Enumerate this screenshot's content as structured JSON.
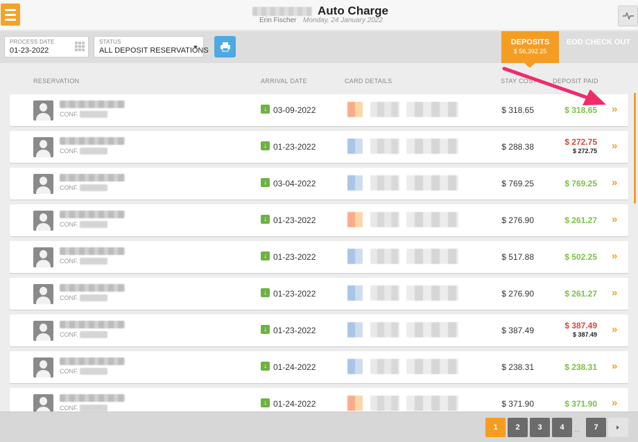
{
  "header": {
    "title": "Auto Charge",
    "user_name": "Erin Fischer",
    "date": "Monday, 24 January 2022"
  },
  "toolbar": {
    "process_date_label": "PROCESS DATE",
    "process_date_value": "01-23-2022",
    "status_label": "STATUS",
    "status_value": "ALL DEPOSIT RESERVATIONS",
    "tabs": {
      "deposits_label": "DEPOSITS",
      "deposits_total": "$ 56,392.25",
      "eod_label": "EOD CHECK OUT"
    }
  },
  "columns": {
    "reservation": "RESERVATION",
    "arrival_date": "ARRIVAL DATE",
    "card_details": "CARD DETAILS",
    "stay_cost": "STAY COST",
    "deposit_paid": "DEPOSIT PAID"
  },
  "rows": [
    {
      "conf_label": "CONF.",
      "arrival": "03-09-2022",
      "card_type": "orange",
      "stay_cost": "$ 318.65",
      "deposit": "$ 318.65",
      "deposit_status": "green",
      "deposit_sub": ""
    },
    {
      "conf_label": "CONF.",
      "arrival": "01-23-2022",
      "card_type": "blue",
      "stay_cost": "$ 288.38",
      "deposit": "$ 272.75",
      "deposit_status": "red",
      "deposit_sub": "$ 272.75"
    },
    {
      "conf_label": "CONF.",
      "arrival": "03-04-2022",
      "card_type": "blue",
      "stay_cost": "$ 769.25",
      "deposit": "$ 769.25",
      "deposit_status": "green",
      "deposit_sub": ""
    },
    {
      "conf_label": "CONF.",
      "arrival": "01-23-2022",
      "card_type": "orange",
      "stay_cost": "$ 276.90",
      "deposit": "$ 261.27",
      "deposit_status": "green",
      "deposit_sub": ""
    },
    {
      "conf_label": "CONF.",
      "arrival": "01-23-2022",
      "card_type": "blue",
      "stay_cost": "$ 517.88",
      "deposit": "$ 502.25",
      "deposit_status": "green",
      "deposit_sub": ""
    },
    {
      "conf_label": "CONF.",
      "arrival": "01-23-2022",
      "card_type": "blue",
      "stay_cost": "$ 276.90",
      "deposit": "$ 261.27",
      "deposit_status": "green",
      "deposit_sub": ""
    },
    {
      "conf_label": "CONF.",
      "arrival": "01-23-2022",
      "card_type": "blue",
      "stay_cost": "$ 387.49",
      "deposit": "$ 387.49",
      "deposit_status": "red",
      "deposit_sub": "$ 387.49"
    },
    {
      "conf_label": "CONF.",
      "arrival": "01-24-2022",
      "card_type": "blue",
      "stay_cost": "$ 238.31",
      "deposit": "$ 238.31",
      "deposit_status": "green",
      "deposit_sub": ""
    },
    {
      "conf_label": "CONF.",
      "arrival": "01-24-2022",
      "card_type": "orange",
      "stay_cost": "$ 371.90",
      "deposit": "$ 371.90",
      "deposit_status": "green",
      "deposit_sub": ""
    }
  ],
  "pagination": {
    "pages": [
      "1",
      "2",
      "3",
      "4",
      "7"
    ],
    "current": "1",
    "ellipsis": "..."
  },
  "colors": {
    "accent": "#f59d22",
    "positive": "#7ac143",
    "negative": "#d9463b",
    "print_button": "#4ea9e2",
    "annotation_arrow": "#ee2c6a"
  }
}
